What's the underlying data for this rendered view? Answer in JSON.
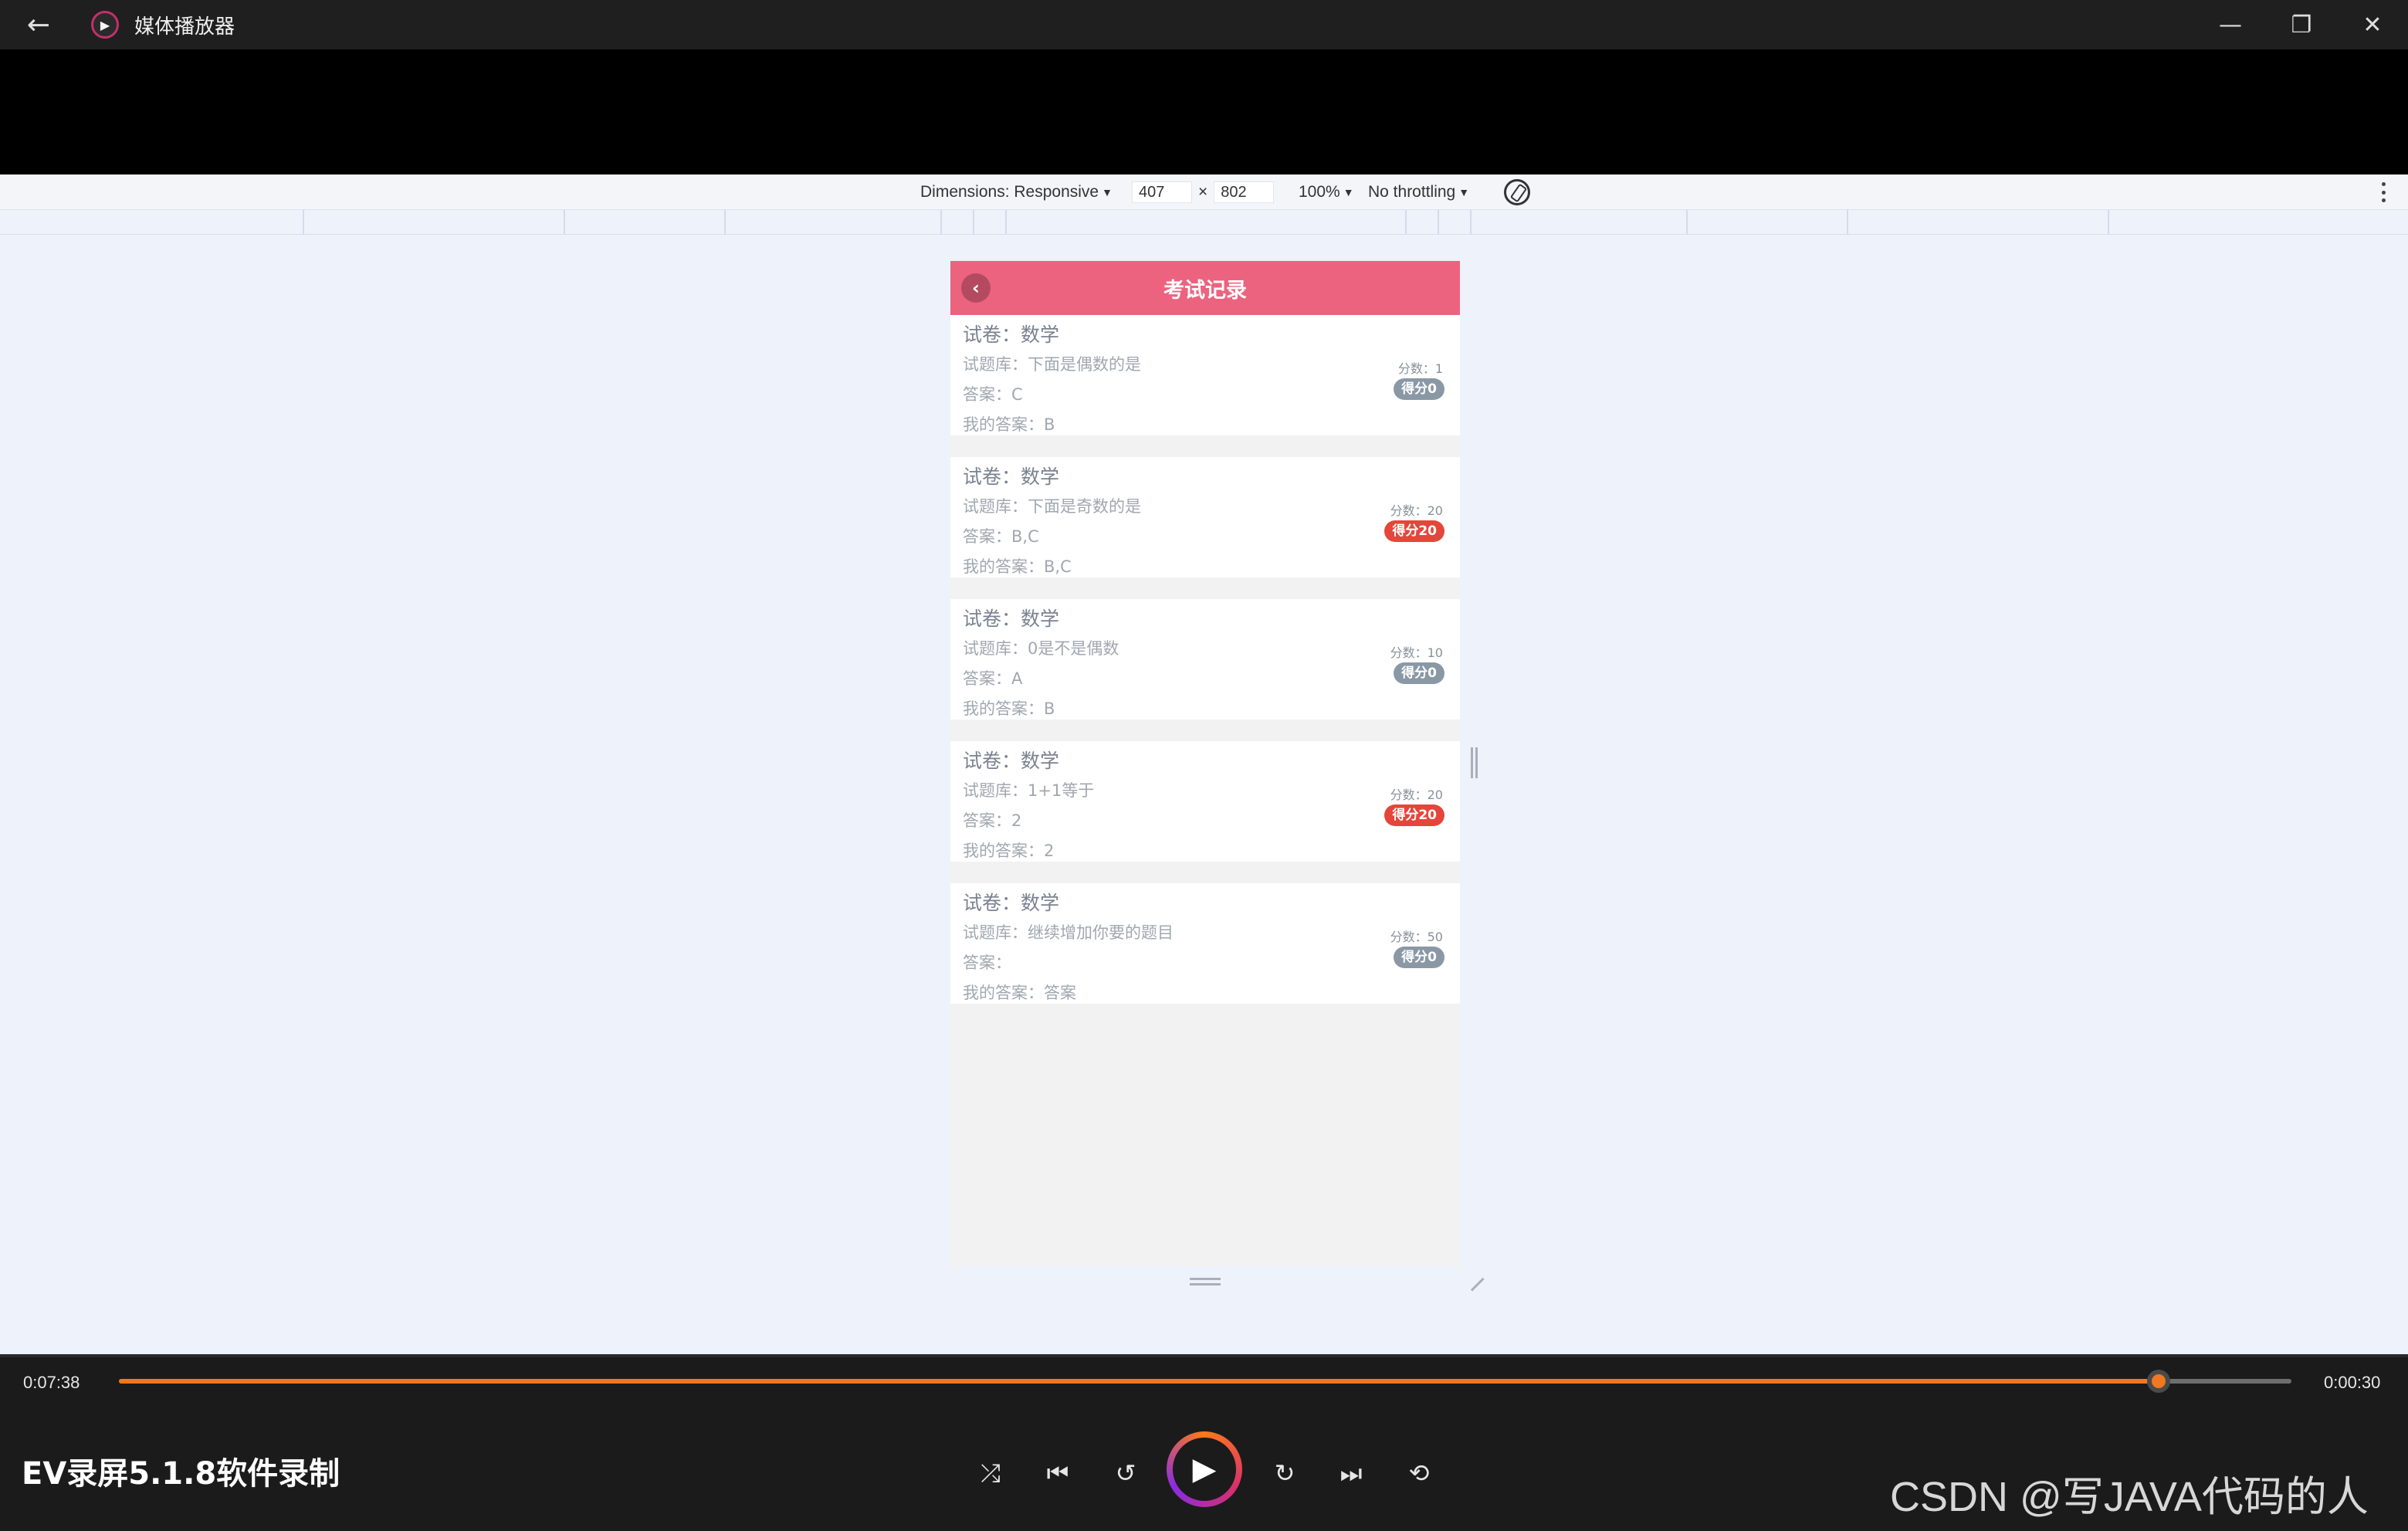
{
  "window": {
    "title": "媒体播放器",
    "back_icon": "←",
    "minimize_icon": "—",
    "maximize_icon": "❐",
    "close_icon": "✕"
  },
  "devtools": {
    "dimensions_label": "Dimensions: Responsive",
    "width": "407",
    "times": "×",
    "height": "802",
    "zoom": "100%",
    "throttling": "No throttling"
  },
  "app": {
    "title": "考试记录",
    "back_icon": "‹",
    "records": [
      {
        "paper": "试卷：数学",
        "question": "试题库：下面是偶数的是",
        "answer": "答案：C",
        "my_answer": "我的答案：B",
        "score": "分数：1",
        "badge": "得分0",
        "badge_type": "zero"
      },
      {
        "paper": "试卷：数学",
        "question": "试题库：下面是奇数的是",
        "answer": "答案：B,C",
        "my_answer": "我的答案：B,C",
        "score": "分数：20",
        "badge": "得分20",
        "badge_type": "full"
      },
      {
        "paper": "试卷：数学",
        "question": "试题库：0是不是偶数",
        "answer": "答案：A",
        "my_answer": "我的答案：B",
        "score": "分数：10",
        "badge": "得分0",
        "badge_type": "zero"
      },
      {
        "paper": "试卷：数学",
        "question": "试题库：1+1等于",
        "answer": "答案：2",
        "my_answer": "我的答案：2",
        "score": "分数：20",
        "badge": "得分20",
        "badge_type": "full"
      },
      {
        "paper": "试卷：数学",
        "question": "试题库：继续增加你要的题目",
        "answer": "答案：",
        "my_answer": "我的答案：答案",
        "score": "分数：50",
        "badge": "得分0",
        "badge_type": "zero"
      }
    ]
  },
  "player": {
    "elapsed": "0:07:38",
    "remaining": "0:00:30",
    "progress": 0.939,
    "caption": "EV录屏5.1.8软件录制",
    "watermark": "CSDN @写JAVA代码的人",
    "accent_color": "#f07820",
    "icons": {
      "shuffle": "⤮",
      "previous": "⏮",
      "rewind10": "↺",
      "play": "▶",
      "forward30": "↻",
      "next": "⏭",
      "repeat": "⟲"
    }
  }
}
